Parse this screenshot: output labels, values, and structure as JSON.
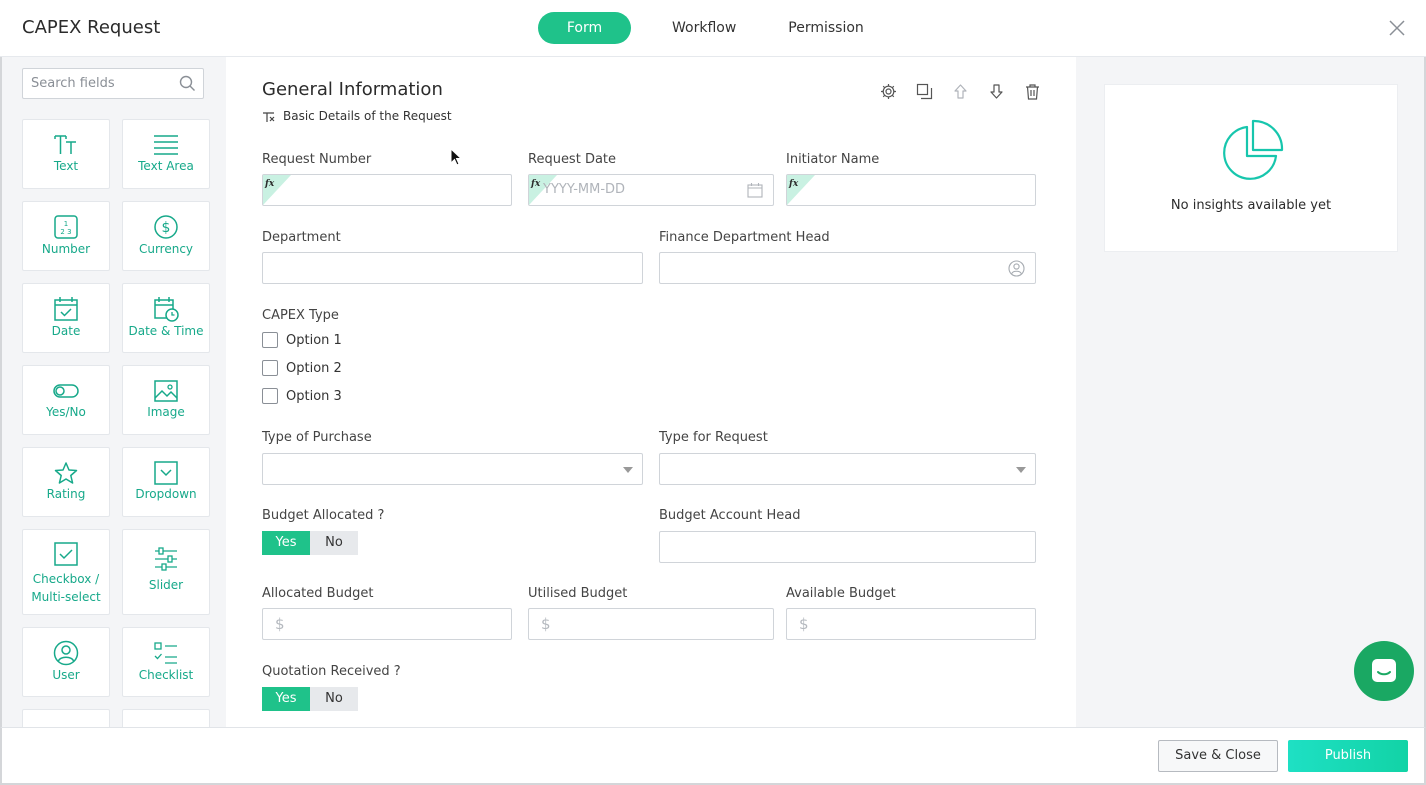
{
  "header": {
    "title": "CAPEX Request",
    "tabs": [
      {
        "label": "Form",
        "active": true
      },
      {
        "label": "Workflow",
        "active": false
      },
      {
        "label": "Permission",
        "active": false
      }
    ]
  },
  "sidebar": {
    "search_placeholder": "Search fields",
    "fields": [
      {
        "label": "Text",
        "icon": "text-icon"
      },
      {
        "label": "Text Area",
        "icon": "text-area-icon"
      },
      {
        "label": "Number",
        "icon": "number-icon"
      },
      {
        "label": "Currency",
        "icon": "currency-icon"
      },
      {
        "label": "Date",
        "icon": "date-icon"
      },
      {
        "label": "Date & Time",
        "icon": "date-time-icon"
      },
      {
        "label": "Yes/No",
        "icon": "yes-no-icon"
      },
      {
        "label": "Image",
        "icon": "image-icon"
      },
      {
        "label": "Rating",
        "icon": "star-icon"
      },
      {
        "label": "Dropdown",
        "icon": "dropdown-icon"
      },
      {
        "label": "Checkbox /",
        "label2": "Multi-select",
        "icon": "checkbox-icon"
      },
      {
        "label": "Slider",
        "icon": "slider-icon"
      },
      {
        "label": "User",
        "icon": "user-icon"
      },
      {
        "label": "Checklist",
        "icon": "checklist-icon"
      }
    ]
  },
  "section": {
    "title": "General Information",
    "subtitle": "Basic Details of the Request"
  },
  "form": {
    "request_number": {
      "label": "Request Number"
    },
    "request_date": {
      "label": "Request Date",
      "placeholder": "YYYY-MM-DD"
    },
    "initiator_name": {
      "label": "Initiator Name"
    },
    "department": {
      "label": "Department"
    },
    "finance_head": {
      "label": "Finance Department Head"
    },
    "capex_type": {
      "label": "CAPEX Type",
      "options": [
        "Option 1",
        "Option 2",
        "Option 3"
      ]
    },
    "type_of_purchase": {
      "label": "Type of Purchase"
    },
    "type_for_request": {
      "label": "Type for Request"
    },
    "budget_allocated": {
      "label": "Budget Allocated ?",
      "yes": "Yes",
      "no": "No"
    },
    "budget_account_head": {
      "label": "Budget Account Head"
    },
    "allocated_budget": {
      "label": "Allocated Budget",
      "prefix": "$"
    },
    "utilised_budget": {
      "label": "Utilised Budget",
      "prefix": "$"
    },
    "available_budget": {
      "label": "Available Budget",
      "prefix": "$"
    },
    "quotation_received": {
      "label": "Quotation Received ?",
      "yes": "Yes",
      "no": "No"
    }
  },
  "insights": {
    "text": "No insights available yet"
  },
  "footer": {
    "save_close": "Save & Close",
    "publish": "Publish"
  },
  "colors": {
    "accent": "#1fc28a",
    "icon_teal": "#17a98a",
    "publish": "#1ee0c4",
    "chat": "#1aa863"
  }
}
